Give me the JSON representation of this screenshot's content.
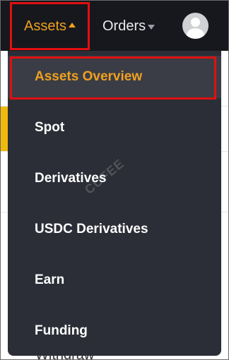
{
  "navbar": {
    "assets_label": "Assets",
    "orders_label": "Orders"
  },
  "dropdown": {
    "items": [
      {
        "label": "Assets Overview"
      },
      {
        "label": "Spot"
      },
      {
        "label": "Derivatives"
      },
      {
        "label": "USDC Derivatives"
      },
      {
        "label": "Earn"
      },
      {
        "label": "Funding"
      }
    ]
  },
  "background": {
    "bottom_text": "Withdraw"
  },
  "watermark": "CUFEE",
  "colors": {
    "nav_bg": "#16181d",
    "menu_bg": "#2b2e36",
    "accent": "#f0a020",
    "highlight": "#e01010"
  }
}
